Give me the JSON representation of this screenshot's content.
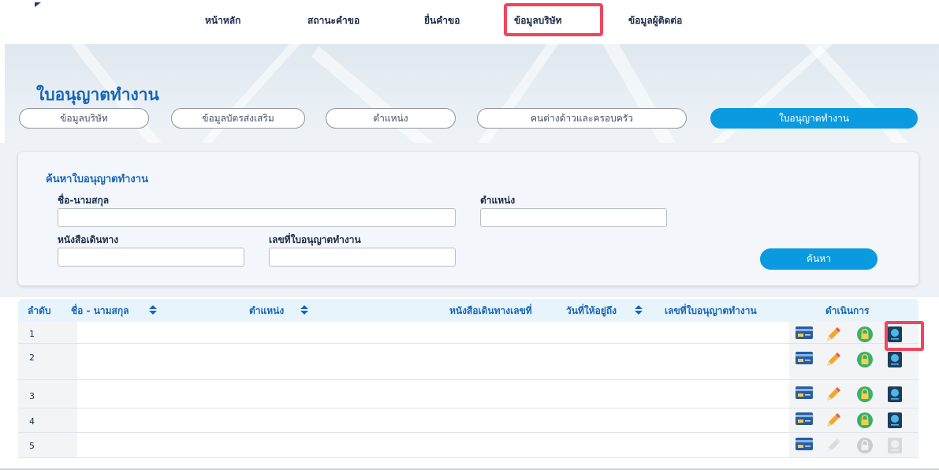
{
  "nav": {
    "items": [
      {
        "label": "หน้าหลัก"
      },
      {
        "label": "สถานะคำขอ"
      },
      {
        "label": "ยื่นคำขอ"
      },
      {
        "label": "ข้อมูลบริษัท"
      },
      {
        "label": "ข้อมูลผู้ติดต่อ"
      }
    ],
    "active": "ข้อมูลบริษัท"
  },
  "page": {
    "title": "ใบอนุญาตทำงาน"
  },
  "tabs": [
    {
      "label": "ข้อมูลบริษัท",
      "active": false
    },
    {
      "label": "ข้อมูลบัตรส่งเสริม",
      "active": false
    },
    {
      "label": "ตำแหน่ง",
      "active": false
    },
    {
      "label": "คนต่างด้าวและครอบครัว",
      "active": false
    },
    {
      "label": "ใบอนุญาตทำงาน",
      "active": true
    }
  ],
  "search": {
    "heading": "ค้นหาใบอนุญาตทำงาน",
    "name_label": "ชื่อ-นามสกุล",
    "name_value": "",
    "position_label": "ตำแหน่ง",
    "position_value": "",
    "passport_label": "หนังสือเดินทาง",
    "passport_value": "",
    "permit_label": "เลขที่ใบอนุญาตทำงาน",
    "permit_value": "",
    "button": "ค้นหา"
  },
  "table": {
    "columns": {
      "index": "ลำดับ",
      "name": "ชื่อ - นามสกุล",
      "position": "ตำแหน่ง",
      "passport": "หนังสือเดินทางเลขที่",
      "stay_until": "วันที่ให้อยู่ถึง",
      "permit_no": "เลขที่ใบอนุญาตทำงาน",
      "actions": "ดำเนินการ"
    },
    "rows": [
      {
        "index": "1",
        "actions_enabled": true
      },
      {
        "index": "2",
        "actions_enabled": true
      },
      {
        "index": "3",
        "actions_enabled": true
      },
      {
        "index": "4",
        "actions_enabled": true
      },
      {
        "index": "5",
        "actions_enabled": false
      }
    ],
    "icons": [
      "id-card-icon",
      "pencil-icon",
      "lock-icon",
      "passport-icon"
    ]
  },
  "colors": {
    "accent": "#0a9ae0",
    "title_blue": "#1767b5",
    "highlight": "#f0455d",
    "lock_green": "#3ab06a"
  }
}
